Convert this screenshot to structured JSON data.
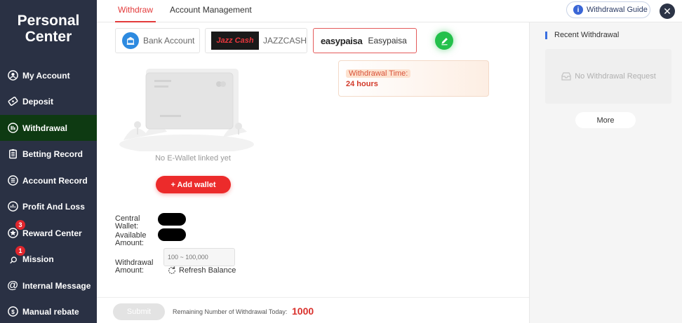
{
  "sidebar": {
    "title_line1": "Personal",
    "title_line2": "Center",
    "items": [
      {
        "label": "My Account",
        "icon": "person-icon"
      },
      {
        "label": "Deposit",
        "icon": "deposit-icon"
      },
      {
        "label": "Withdrawal",
        "icon": "withdrawal-icon",
        "active": true
      },
      {
        "label": "Betting Record",
        "icon": "clipboard-icon"
      },
      {
        "label": "Account Record",
        "icon": "list-icon"
      },
      {
        "label": "Profit And Loss",
        "icon": "profit-icon"
      },
      {
        "label": "Reward Center",
        "icon": "gift-icon",
        "badge": "3"
      },
      {
        "label": "Mission",
        "icon": "search-icon",
        "badge": "1"
      },
      {
        "label": "Internal Message",
        "icon": "at-icon"
      },
      {
        "label": "Manual rebate",
        "icon": "rebate-icon"
      }
    ]
  },
  "tabs": [
    {
      "label": "Withdraw",
      "active": true
    },
    {
      "label": "Account Management"
    }
  ],
  "guide_label": "Withdrawal Guide",
  "methods": [
    {
      "label": "Bank Account",
      "icon": "bank-icon"
    },
    {
      "label": "JAZZCASH",
      "logo_text": "Jazz Cash"
    },
    {
      "label": "Easypaisa",
      "logo_text": "easypaisa",
      "selected": true
    }
  ],
  "withdrawal_time": {
    "label": "Withdrawal Time:",
    "value": "24 hours"
  },
  "wallet": {
    "empty_text": "No E-Wallet linked yet",
    "add_label": "+ Add wallet",
    "central_wallet_label": "Central Wallet:",
    "available_amount_label": "Available Amount:",
    "withdrawal_amount_label": "Withdrawal Amount:",
    "amount_placeholder": "100 ~ 100,000",
    "refresh_label": "Refresh Balance"
  },
  "bottom": {
    "submit_label": "Submit",
    "remaining_label": "Remaining Number of Withdrawal Today:",
    "remaining_value": "1000"
  },
  "recent": {
    "title": "Recent Withdrawal",
    "empty_text": "No Withdrawal Request",
    "more_label": "More"
  },
  "colors": {
    "accent": "#e33a3a",
    "sidebar_bg": "#2a3144",
    "active_nav": "#0e3a12",
    "edit_green": "#23c04b"
  }
}
